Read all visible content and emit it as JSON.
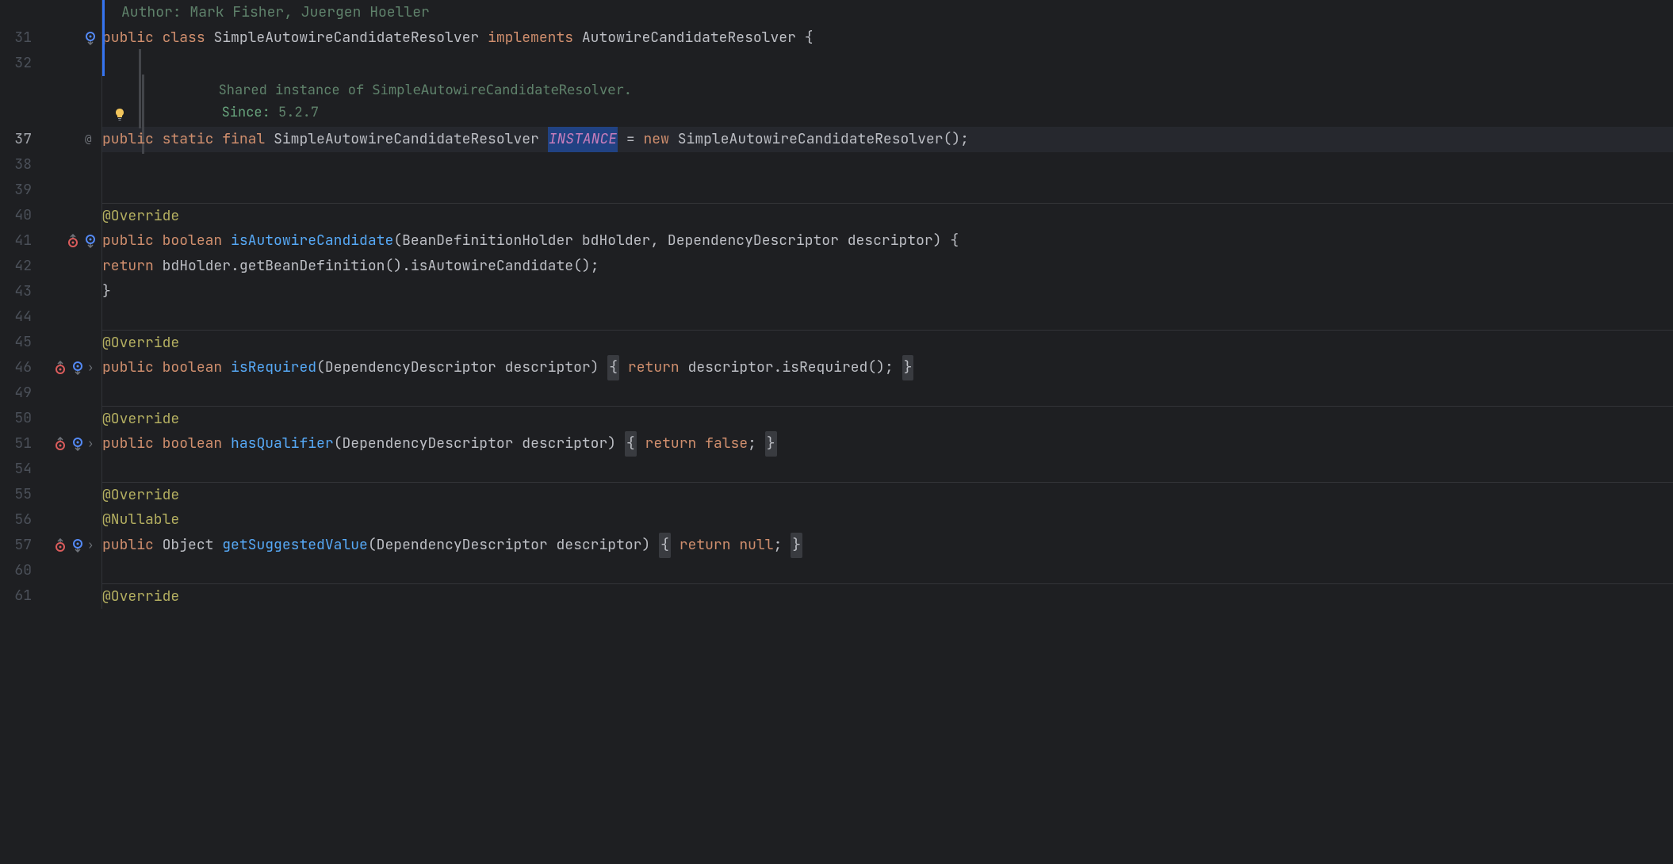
{
  "authorLine": "Author: Mark Fisher, Juergen Hoeller",
  "doc": {
    "sharedPrefix": "Shared instance of ",
    "sharedType": "SimpleAutowireCandidateResolver",
    "sharedSuffix": ".",
    "sinceLabel": "Since:",
    "sinceVersion": " 5.2.7"
  },
  "kw": {
    "public": "public",
    "class": "class",
    "implements": "implements",
    "static": "static",
    "final": "final",
    "new": "new",
    "boolean": "boolean",
    "return": "return",
    "false": "false",
    "null": "null"
  },
  "types": {
    "className": "SimpleAutowireCandidateResolver",
    "implInterface": "AutowireCandidateResolver",
    "bdh": "BeanDefinitionHolder",
    "dd": "DependencyDescriptor",
    "object": "Object"
  },
  "ann": {
    "override": "@Override",
    "nullable": "@Nullable"
  },
  "fields": {
    "instance": "INSTANCE"
  },
  "methods": {
    "isAutowireCandidate": "isAutowireCandidate",
    "isRequired": "isRequired",
    "hasQualifier": "hasQualifier",
    "getSuggestedValue": "getSuggestedValue",
    "getBeanDefinition": "getBeanDefinition"
  },
  "params": {
    "bdHolder": "bdHolder",
    "descriptor": "descriptor"
  },
  "punct": {
    "openParen": "(",
    "closeParen": ")",
    "openBrace": "{",
    "closeBrace": "}",
    "comma": ", ",
    "semi": ";",
    "dot": ".",
    "eq": " = ",
    "space": " ",
    "emptyCall": "()",
    "newCall": "();"
  },
  "lineNumbers": [
    "",
    "31",
    "32",
    "",
    "",
    "37",
    "38",
    "39",
    "40",
    "41",
    "42",
    "43",
    "44",
    "45",
    "46",
    "49",
    "50",
    "51",
    "54",
    "55",
    "56",
    "57",
    "60",
    "61"
  ]
}
